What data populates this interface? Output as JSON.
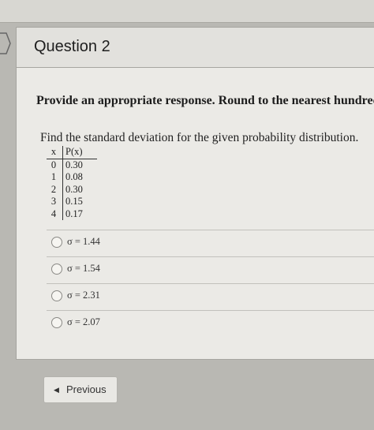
{
  "question": {
    "title": "Question 2",
    "instruction": "Provide an appropriate response. Round to the nearest hundredth",
    "prompt": "Find the standard deviation for the given probability distribution."
  },
  "distribution": {
    "headers": {
      "x": "x",
      "p": "P(x)"
    },
    "rows": [
      {
        "x": "0",
        "p": "0.30"
      },
      {
        "x": "1",
        "p": "0.08"
      },
      {
        "x": "2",
        "p": "0.30"
      },
      {
        "x": "3",
        "p": "0.15"
      },
      {
        "x": "4",
        "p": "0.17"
      }
    ]
  },
  "options": [
    {
      "label": "σ = 1.44"
    },
    {
      "label": "σ = 1.54"
    },
    {
      "label": "σ = 2.31"
    },
    {
      "label": "σ = 2.07"
    }
  ],
  "navigation": {
    "previous_label": "Previous",
    "previous_icon": "chevron-left-icon"
  }
}
